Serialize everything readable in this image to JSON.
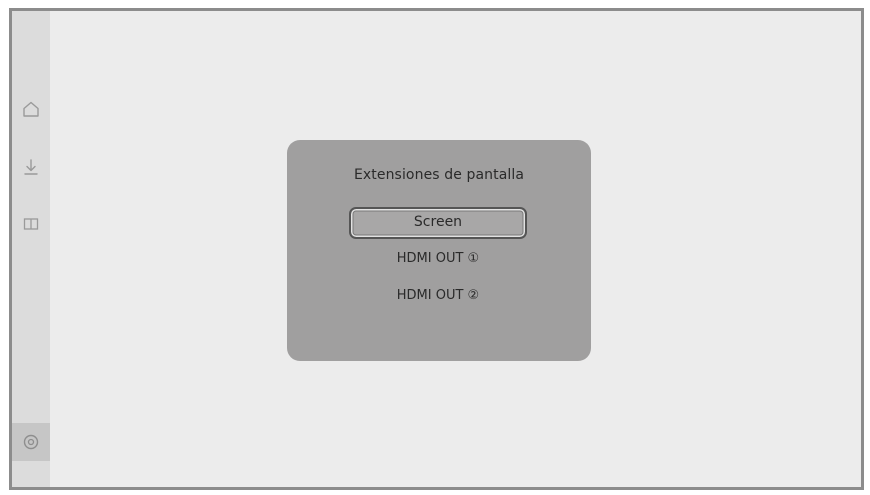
{
  "sidebar": {
    "icons": [
      {
        "name": "home-icon"
      },
      {
        "name": "download-icon"
      },
      {
        "name": "book-icon"
      },
      {
        "name": "settings-icon"
      }
    ]
  },
  "dialog": {
    "title": "Extensiones de pantalla",
    "options": [
      {
        "label": "Screen",
        "focused": true
      },
      {
        "label": "HDMI OUT ①",
        "focused": false
      },
      {
        "label": "HDMI OUT ②",
        "focused": false
      }
    ]
  },
  "colors": {
    "screen_background": "#ececec",
    "sidebar_background": "#dcdcdc",
    "dialog_background": "#a09f9f",
    "frame_border": "#8c8c8c",
    "text": "#2a2a2a"
  }
}
